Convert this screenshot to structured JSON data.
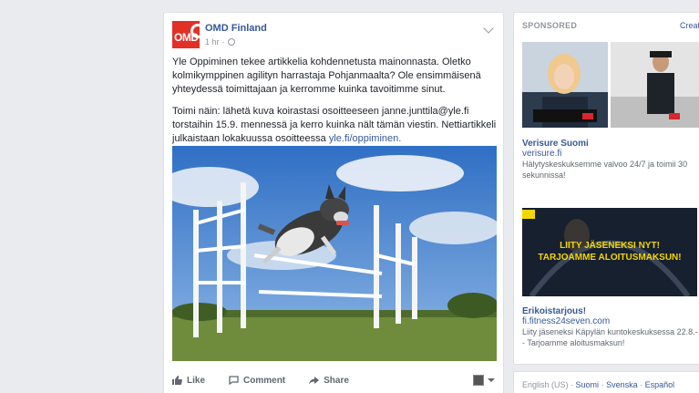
{
  "post": {
    "page_name": "OMD Finland",
    "avatar_text": "OMD",
    "time": "1 hr",
    "dot": "·",
    "paragraph1": "Yle Oppiminen tekee artikkelia kohdennetusta mainonnasta. Oletko kolmikymppinen agilityn harrastaja Pohjanmaalta? Ole ensimmäisenä yhteydessä toimittajaan ja kerromme kuinka tavoitimme sinut.",
    "paragraph2_text": "Toimi näin: lähetä kuva koirastasi osoitteeseen janne.junttila@yle.fi torstaihin 15.9. mennessä ja kerro kuinka nält tämän viestin. Nettiartikkeli julkaistaan lokakuussa osoitteessa ",
    "paragraph2_link": "yle.fi/oppiminen.",
    "actions": {
      "like": "Like",
      "comment": "Comment",
      "share": "Share"
    }
  },
  "sidebar": {
    "sponsored_label": "SPONSORED",
    "create_label": "Creat",
    "ad1": {
      "title": "Verisure Suomi",
      "link": "verisure.fi",
      "description": "Hälytyskeskuksemme valvoo 24/7 ja toimii 30 sekunnissa!"
    },
    "ad2": {
      "image_line1": "LIITY JÄSENEKSI NYT!",
      "image_line2": "TARJOAMME ALOITUSMAKSUN!",
      "title": "Erikoistarjous!",
      "link": "fi.fitness24seven.com",
      "description": "Liity jäseneksi Käpylän kuntokeskuksessa 22.8.-- Tarjoamme aloitusmaksun!"
    },
    "languages": {
      "current": "English (US)",
      "separator": "·",
      "others": [
        "Suomi",
        "Svenska",
        "Español"
      ]
    }
  },
  "colors": {
    "link": "#365899",
    "background": "#e9ebee",
    "omd_red": "#e23027"
  }
}
